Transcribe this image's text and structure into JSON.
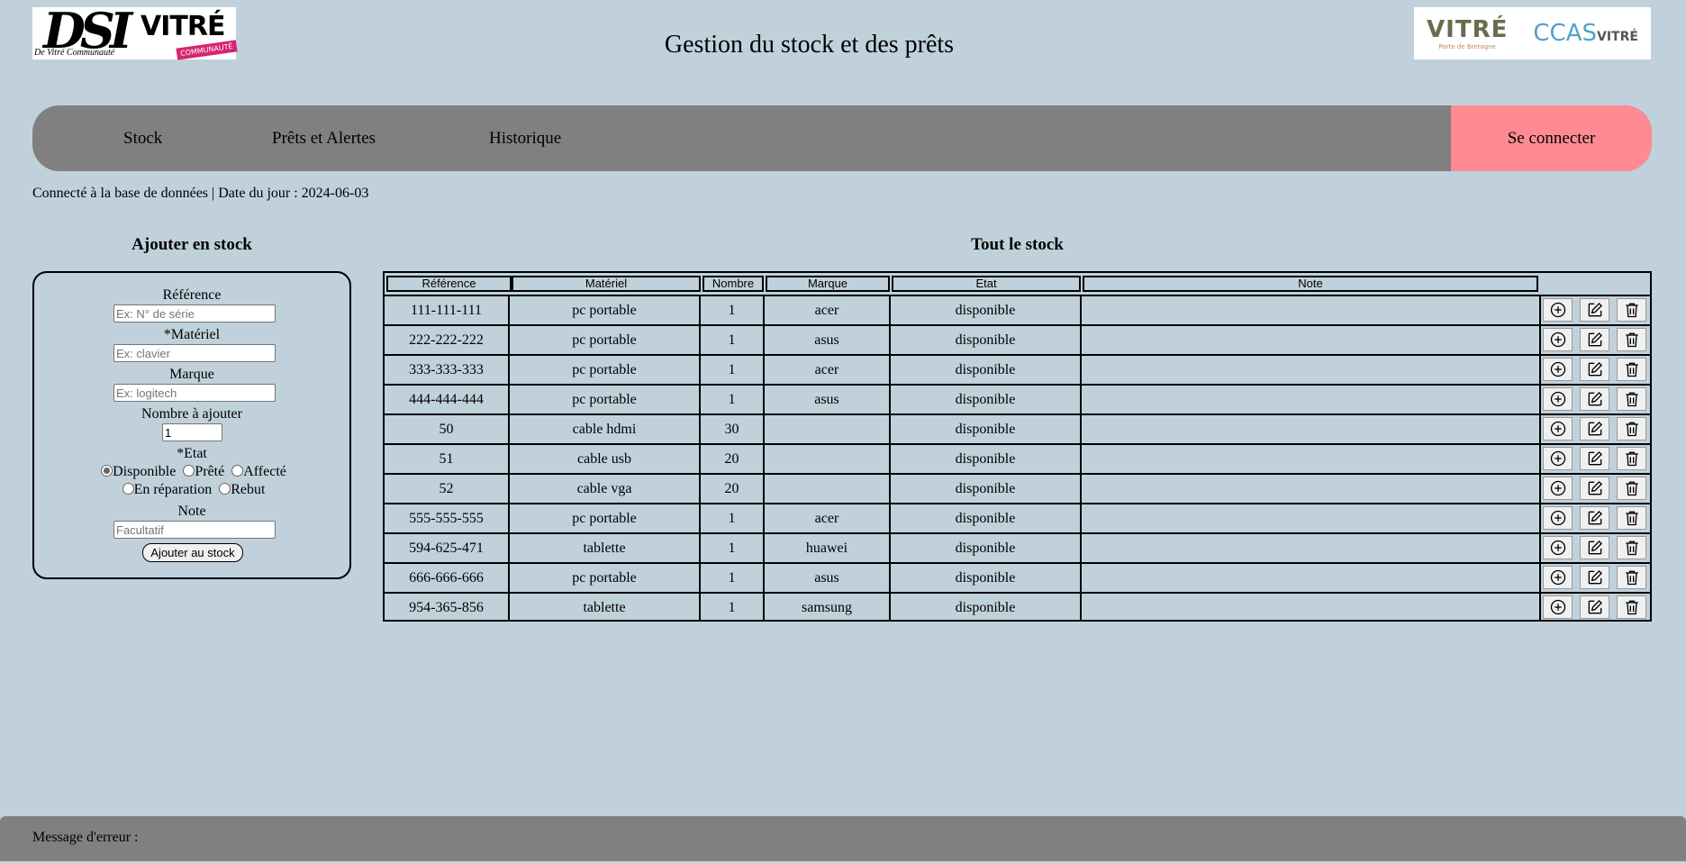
{
  "header": {
    "title": "Gestion du stock et des prêts",
    "logo_dsi_text": "DSI",
    "logo_dsi_caption": "De Vitré Communauté",
    "logo_vitre_text": "VITRÉ",
    "logo_vitre_band": "COMMUNAUTÉ",
    "logo_right_vitre": "VITRÉ",
    "logo_right_vitre_sub": "Porte de Bretagne",
    "logo_right_ccas": "CCAS",
    "logo_right_ccas_sub": "VITRÉ"
  },
  "nav": {
    "items": [
      "Stock",
      "Prêts et Alertes",
      "Historique"
    ],
    "login": "Se connecter"
  },
  "status": "Connecté à la base de données | Date du jour : 2024-06-03",
  "add_form": {
    "title": "Ajouter en stock",
    "reference_label": "Référence",
    "reference_placeholder": "Ex: N° de série",
    "materiel_label": "*Matériel",
    "materiel_placeholder": "Ex: clavier",
    "marque_label": "Marque",
    "marque_placeholder": "Ex: logitech",
    "nombre_label": "Nombre à ajouter",
    "nombre_value": "1",
    "etat_label": "*Etat",
    "etat_options": [
      "Disponible",
      "Prêté",
      "Affecté",
      "En réparation",
      "Rebut"
    ],
    "etat_selected": "Disponible",
    "note_label": "Note",
    "note_placeholder": "Facultatif",
    "submit": "Ajouter au stock"
  },
  "stock": {
    "title": "Tout le stock",
    "columns": [
      "Référence",
      "Matériel",
      "Nombre",
      "Marque",
      "Etat",
      "Note"
    ],
    "rows": [
      [
        "111-111-111",
        "pc portable",
        "1",
        "acer",
        "disponible",
        ""
      ],
      [
        "222-222-222",
        "pc portable",
        "1",
        "asus",
        "disponible",
        ""
      ],
      [
        "333-333-333",
        "pc portable",
        "1",
        "acer",
        "disponible",
        ""
      ],
      [
        "444-444-444",
        "pc portable",
        "1",
        "asus",
        "disponible",
        ""
      ],
      [
        "50",
        "cable hdmi",
        "30",
        "",
        "disponible",
        ""
      ],
      [
        "51",
        "cable usb",
        "20",
        "",
        "disponible",
        ""
      ],
      [
        "52",
        "cable vga",
        "20",
        "",
        "disponible",
        ""
      ],
      [
        "555-555-555",
        "pc portable",
        "1",
        "acer",
        "disponible",
        ""
      ],
      [
        "594-625-471",
        "tablette",
        "1",
        "huawei",
        "disponible",
        ""
      ],
      [
        "666-666-666",
        "pc portable",
        "1",
        "asus",
        "disponible",
        ""
      ],
      [
        "954-365-856",
        "tablette",
        "1",
        "samsung",
        "disponible",
        ""
      ]
    ],
    "row_actions": [
      "plus-circle-icon",
      "edit-icon",
      "trash-icon"
    ]
  },
  "footer": {
    "message_label": "Message d'erreur :"
  },
  "colors": {
    "background": "#c0d1db",
    "navbar": "#808080",
    "login": "#ff8a94"
  }
}
